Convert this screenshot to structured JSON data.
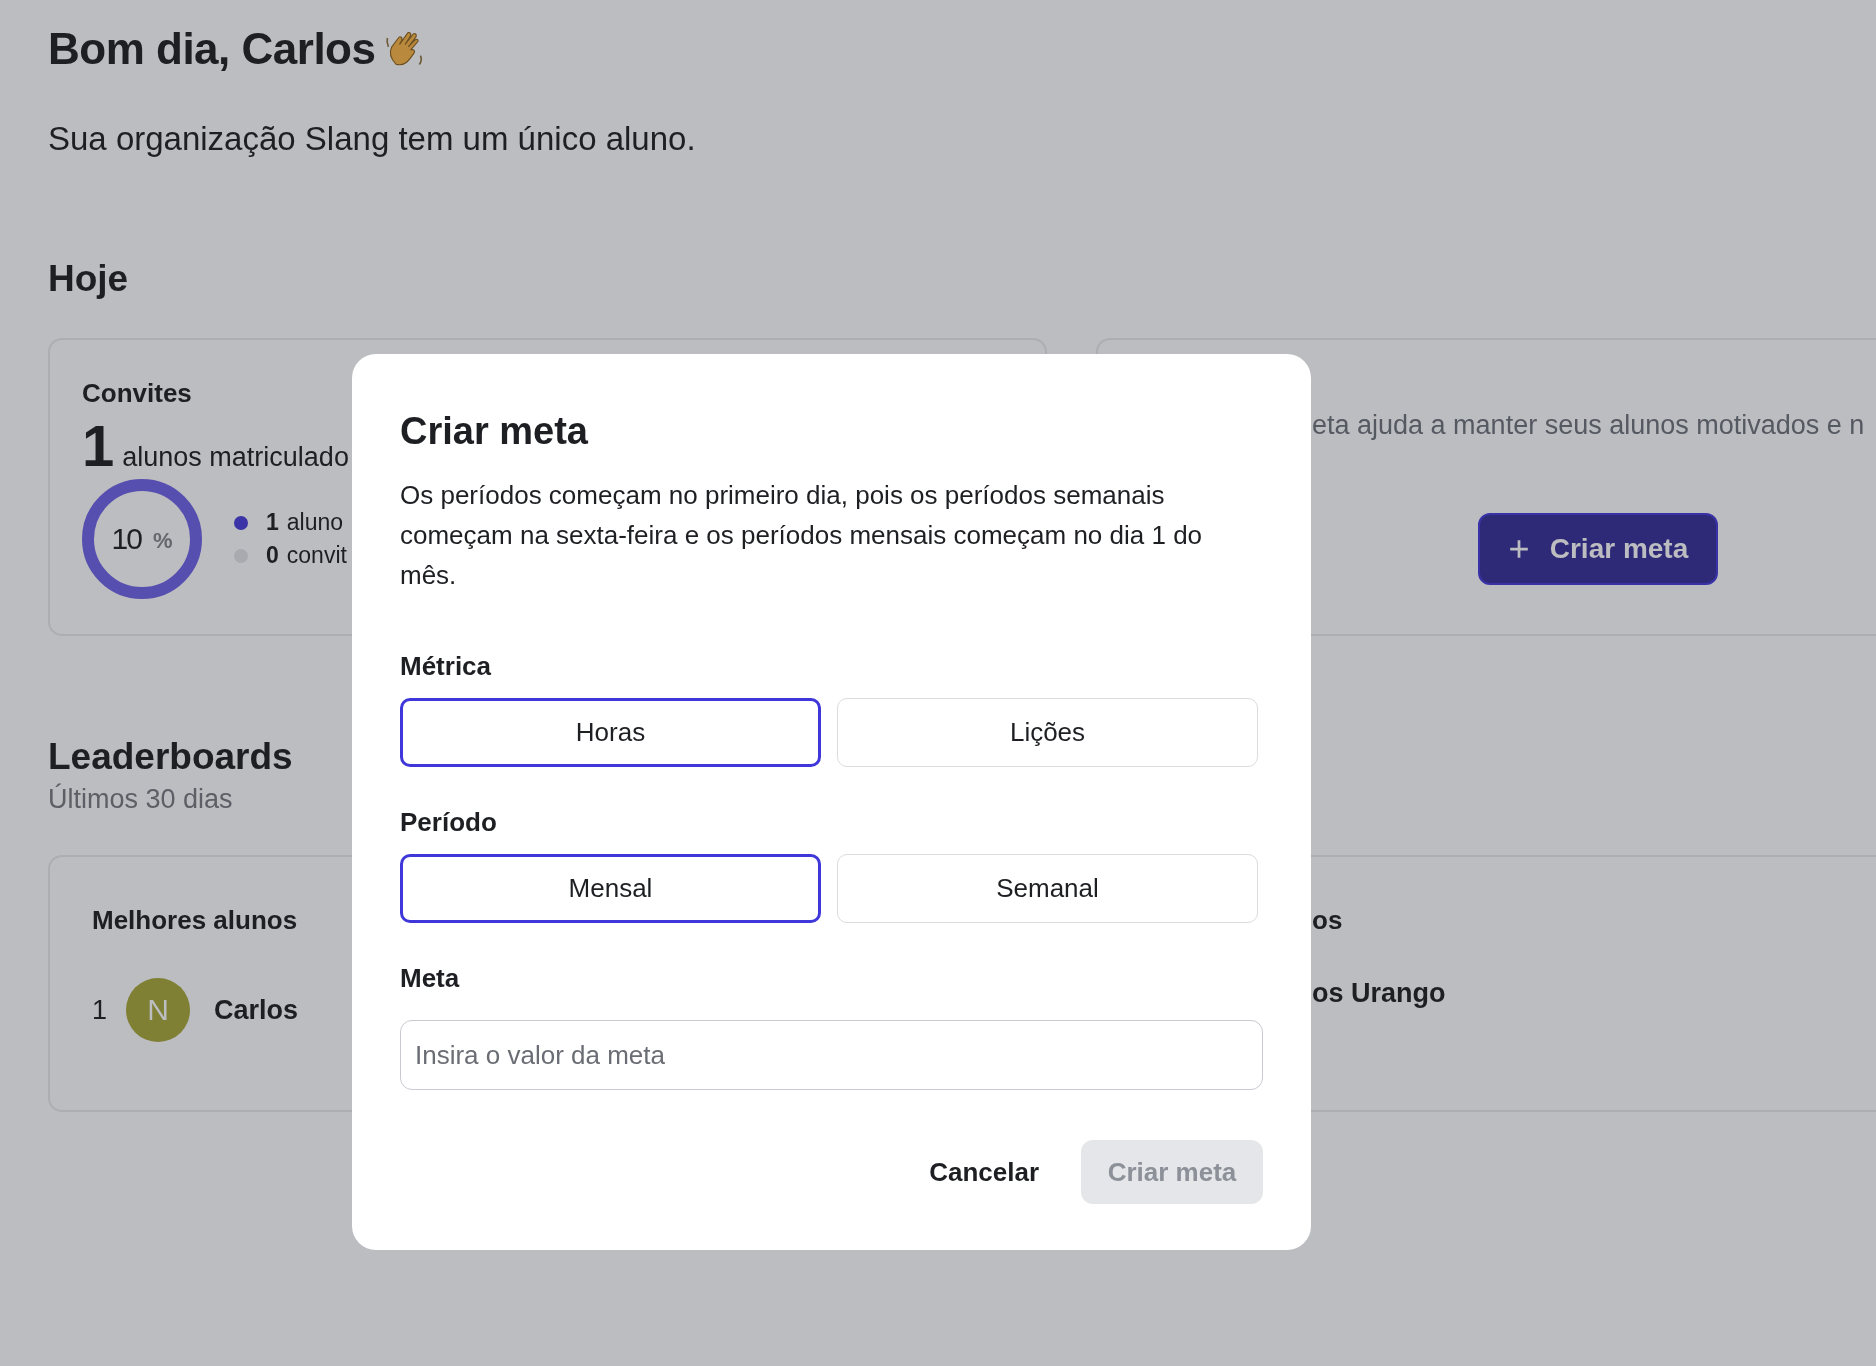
{
  "greeting": {
    "title": "Bom dia, Carlos",
    "subtitle": "Sua organização Slang tem um único aluno."
  },
  "today": {
    "heading": "Hoje",
    "invites_card": {
      "title": "Convites",
      "count": "1",
      "count_label": "alunos matriculado",
      "ring_value": "10",
      "ring_unit": "%",
      "legend": [
        {
          "count": "1",
          "label": "aluno",
          "color": "#3a34a6"
        },
        {
          "count": "0",
          "label": "convit",
          "color": "#a9aab0"
        }
      ]
    },
    "goal_card": {
      "text": "eta ajuda a manter seus alunos motivados e n",
      "button": "Criar meta"
    }
  },
  "leaderboards": {
    "heading": "Leaderboards",
    "subtitle": "Últimos 30 dias",
    "left_card": {
      "title": "Melhores alunos",
      "rows": [
        {
          "rank": "1",
          "initial": "N",
          "name": "Carlos",
          "color": "#7f8034"
        }
      ]
    },
    "right_card": {
      "title": "os",
      "rows": [
        {
          "name": "os Urango"
        }
      ]
    }
  },
  "modal": {
    "title": "Criar meta",
    "description": "Os períodos começam no primeiro dia, pois os períodos semanais começam na sexta-feira e os períodos mensais começam no dia 1 do mês.",
    "metric": {
      "label": "Métrica",
      "options": [
        {
          "label": "Horas",
          "selected": true
        },
        {
          "label": "Lições",
          "selected": false
        }
      ]
    },
    "period": {
      "label": "Período",
      "options": [
        {
          "label": "Mensal",
          "selected": true
        },
        {
          "label": "Semanal",
          "selected": false
        }
      ]
    },
    "goal": {
      "label": "Meta",
      "placeholder": "Insira o valor da meta"
    },
    "cancel": "Cancelar",
    "submit": {
      "label": "Criar meta",
      "disabled": true
    }
  }
}
